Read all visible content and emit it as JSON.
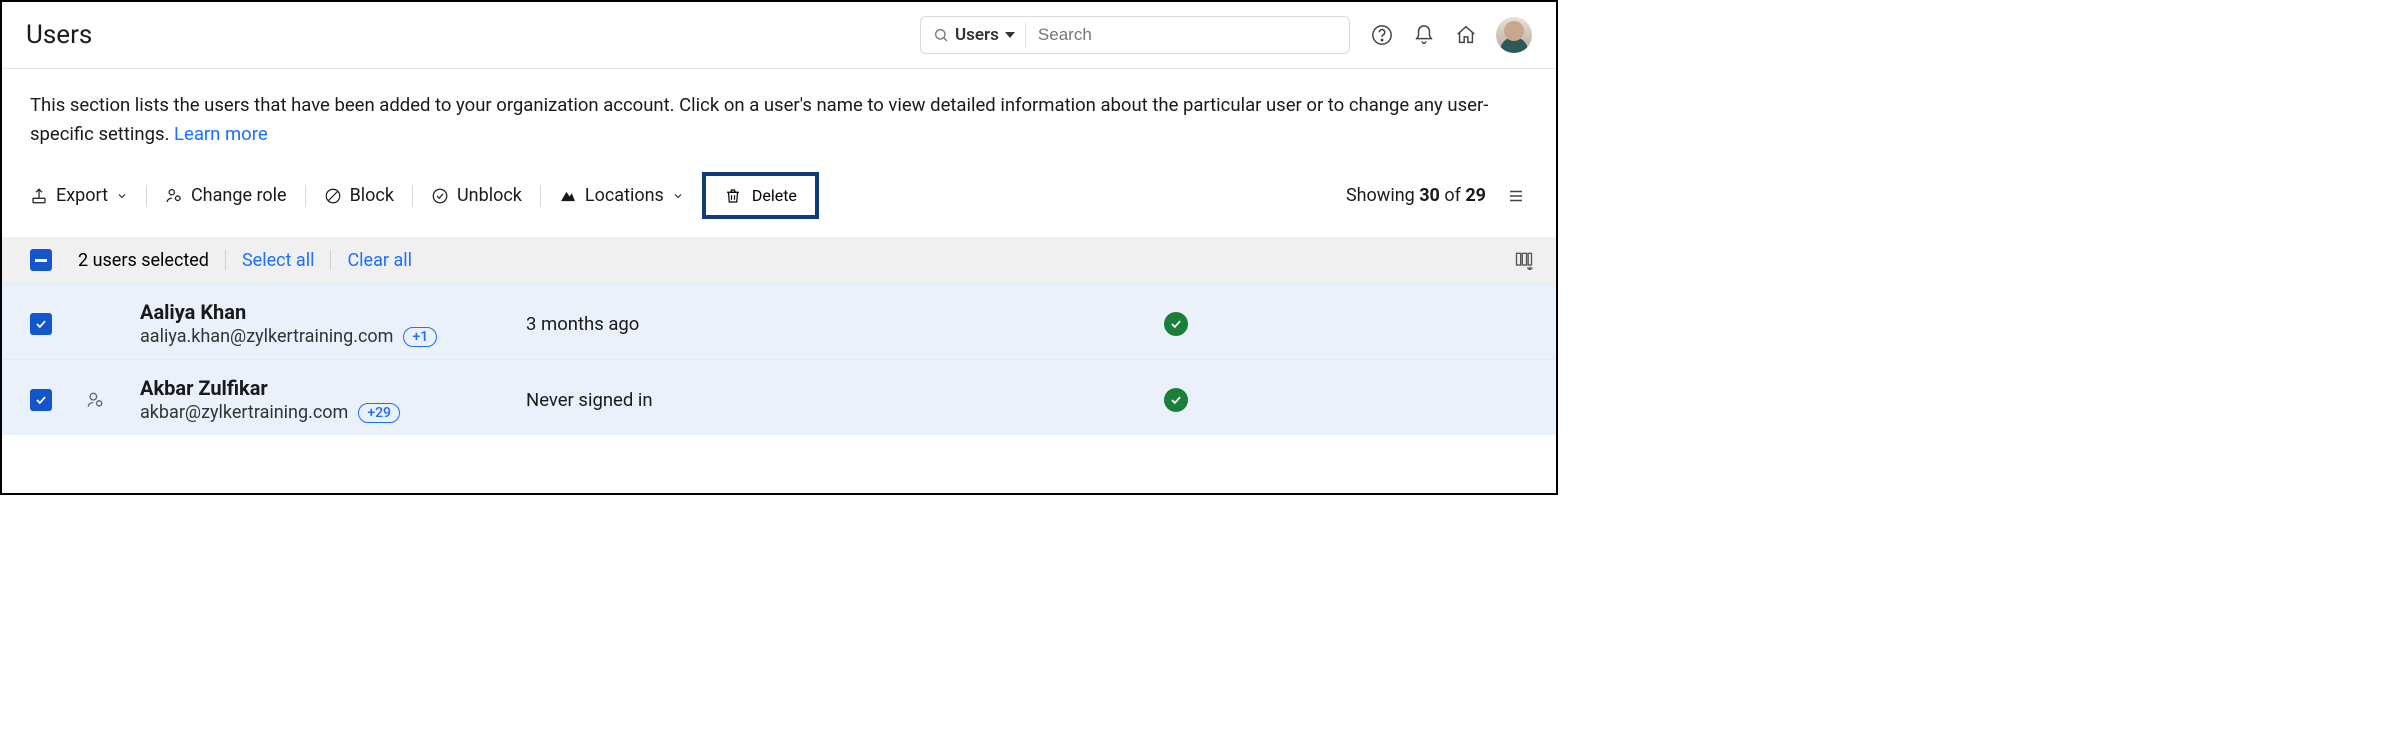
{
  "header": {
    "title": "Users",
    "search": {
      "scope": "Users",
      "placeholder": "Search"
    }
  },
  "description": {
    "text": "This section lists the users that have been added to your organization account. Click on a user's name to view detailed information about the particular user or to change any user-specific settings.  ",
    "learn_more": "Learn more"
  },
  "toolbar": {
    "export": "Export",
    "change_role": "Change role",
    "block": "Block",
    "unblock": "Unblock",
    "locations": "Locations",
    "delete": "Delete",
    "showing_prefix": "Showing ",
    "showing_start": "30",
    "showing_mid": " of ",
    "showing_total": "29"
  },
  "selection": {
    "count_text": "2 users selected",
    "select_all": "Select all",
    "clear_all": "Clear all"
  },
  "rows": [
    {
      "name": "Aaliya Khan",
      "email": "aaliya.khan@zylkertraining.com",
      "badge": "+1",
      "time": "3 months ago",
      "checked": true,
      "has_role_icon": false
    },
    {
      "name": "Akbar Zulfikar",
      "email": "akbar@zylkertraining.com",
      "badge": "+29",
      "time": "Never signed in",
      "checked": true,
      "has_role_icon": true
    }
  ]
}
